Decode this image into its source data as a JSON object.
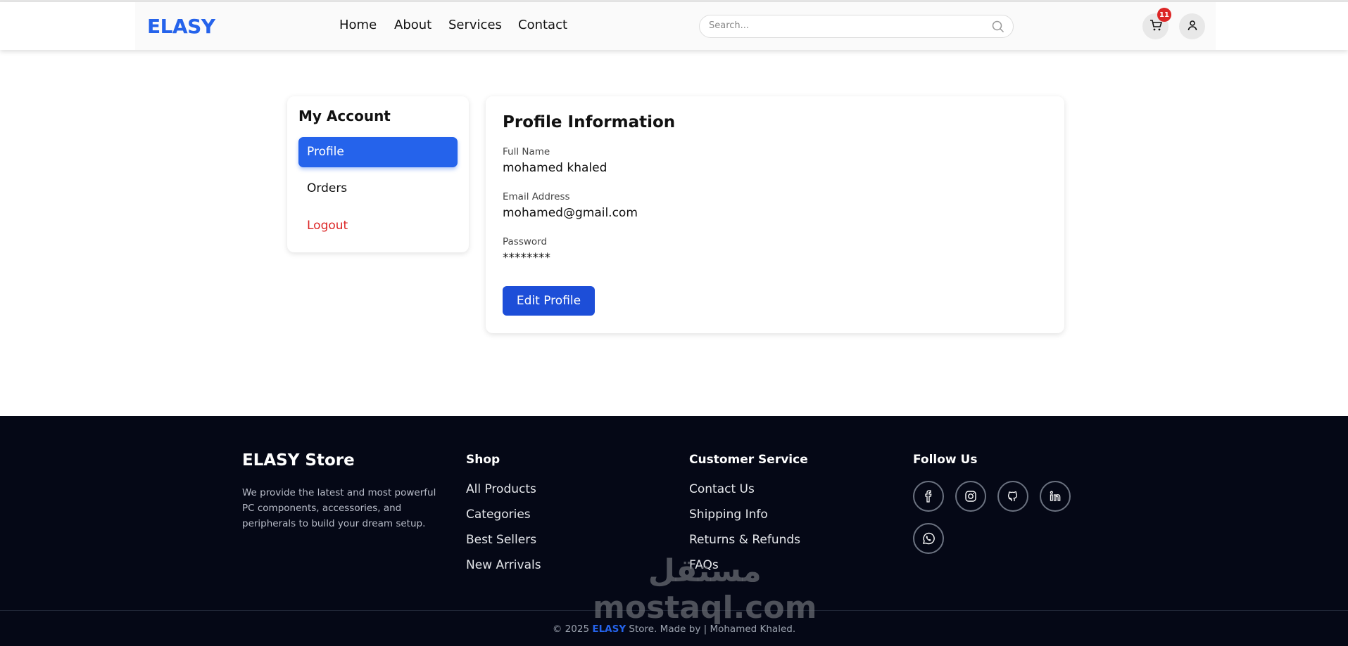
{
  "header": {
    "logo": "ELASY",
    "nav": [
      "Home",
      "About",
      "Services",
      "Contact"
    ],
    "search_placeholder": "Search...",
    "cart_count": "11",
    "brand_color": "#2563eb"
  },
  "sidebar": {
    "title": "My Account",
    "items": [
      {
        "label": "Profile",
        "active": true
      },
      {
        "label": "Orders"
      },
      {
        "label": "Logout",
        "color": "#dc2626"
      }
    ]
  },
  "profile": {
    "title": "Profile Information",
    "fields": [
      {
        "label": "Full Name",
        "value": "mohamed khaled"
      },
      {
        "label": "Email Address",
        "value": "mohamed@gmail.com"
      },
      {
        "label": "Password",
        "value": "********"
      }
    ],
    "edit_label": "Edit Profile"
  },
  "footer": {
    "brand": "ELASY Store",
    "description": "We provide the latest and most powerful PC components, accessories, and peripherals to build your dream setup.",
    "shop": {
      "title": "Shop",
      "links": [
        "All Products",
        "Categories",
        "Best Sellers",
        "New Arrivals"
      ]
    },
    "service": {
      "title": "Customer Service",
      "links": [
        "Contact Us",
        "Shipping Info",
        "Returns & Refunds",
        "FAQs"
      ]
    },
    "follow": {
      "title": "Follow Us",
      "icons": [
        "facebook-icon",
        "instagram-icon",
        "github-icon",
        "linkedin-icon",
        "whatsapp-icon"
      ]
    },
    "copyright_pre": "© 2025 ",
    "copyright_brand": "ELASY",
    "copyright_post": " Store. Made by | Mohamed Khaled."
  },
  "watermark": {
    "arabic": "مستقل",
    "latin": "mostaql.com"
  }
}
